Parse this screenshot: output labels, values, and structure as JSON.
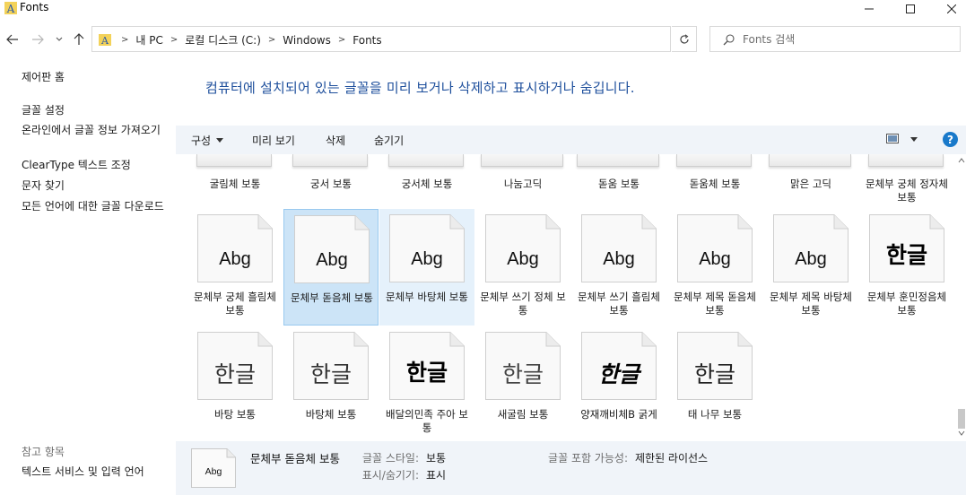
{
  "window": {
    "title": "Fonts"
  },
  "address": {
    "crumbs": [
      "내 PC",
      "로컬 디스크 (C:)",
      "Windows",
      "Fonts"
    ]
  },
  "search": {
    "placeholder": "Fonts 검색"
  },
  "left_pane": {
    "home": "제어판 홈",
    "links": [
      "글꼴 설정",
      "온라인에서 글꼴 정보 가져오기",
      "ClearType 텍스트 조정",
      "문자 찾기",
      "모든 언어에 대한 글꼴 다운로드"
    ],
    "see_also_heading": "참고 항목",
    "see_also_link": "텍스트 서비스 및 입력 언어"
  },
  "headline": "컴퓨터에 설치되어 있는 글꼴을 미리 보거나 삭제하고 표시하거나 숨깁니다.",
  "command_bar": {
    "organize": "구성",
    "preview": "미리 보기",
    "delete": "삭제",
    "hide": "숨기기",
    "help": "?"
  },
  "fonts": {
    "row0": [
      "굴림체 보통",
      "궁서 보통",
      "궁서체 보통",
      "나눔고딕",
      "돋움 보통",
      "돋움체 보통",
      "맑은 고딕",
      "문체부 궁체 정자체 보통"
    ],
    "row1": [
      {
        "name": "문체부 궁체 흘림체 보통",
        "sample": "Abg"
      },
      {
        "name": "문체부 돋음체 보통",
        "sample": "Abg"
      },
      {
        "name": "문체부 바탕체 보통",
        "sample": "Abg"
      },
      {
        "name": "문체부 쓰기 정체 보통",
        "sample": "Abg"
      },
      {
        "name": "문체부 쓰기 흘림체 보통",
        "sample": "Abg"
      },
      {
        "name": "문체부 제목 돋음체 보통",
        "sample": "Abg"
      },
      {
        "name": "문체부 제목 바탕체 보통",
        "sample": "Abg"
      },
      {
        "name": "문체부 훈민정음체 보통",
        "sample": "한글"
      }
    ],
    "row2": [
      {
        "name": "바탕 보통",
        "sample": "한글"
      },
      {
        "name": "바탕체 보통",
        "sample": "한글"
      },
      {
        "name": "배달의민족 주아 보통",
        "sample": "한글"
      },
      {
        "name": "새굴림 보통",
        "sample": "한글"
      },
      {
        "name": "양재깨비체B 굵게",
        "sample": "한글"
      },
      {
        "name": "태 나무 보통",
        "sample": "한글"
      }
    ]
  },
  "details": {
    "thumb_sample": "Abg",
    "name": "문체부 돋음체 보통",
    "style_label": "글꼴 스타일:",
    "style_value": "보통",
    "show_label": "표시/숨기기:",
    "show_value": "표시",
    "embed_label": "글꼴 포함 가능성:",
    "embed_value": "제한된 라이선스"
  },
  "colors": {
    "accent_blue": "#1e4f9c",
    "selected_bg": "#cce4f7",
    "hover_bg": "#e5f1fb",
    "bar_bg": "#f0f4f9",
    "help_blue": "#1979ca"
  }
}
